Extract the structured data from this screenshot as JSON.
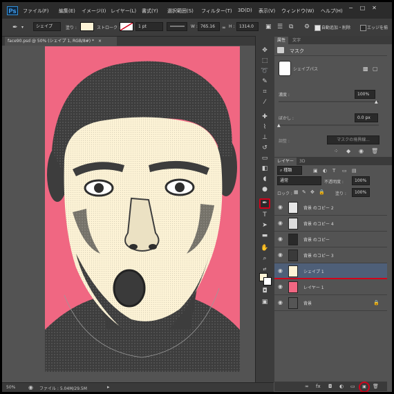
{
  "app": {
    "logo": "Ps"
  },
  "menu": [
    "ファイル(F)",
    "編集(E)",
    "イメージ(I)",
    "レイヤー(L)",
    "書式(Y)",
    "選択範囲(S)",
    "フィルター(T)",
    "3D(D)",
    "表示(V)",
    "ウィンドウ(W)",
    "ヘルプ(H)"
  ],
  "window_controls": [
    "−",
    "□",
    "✕"
  ],
  "options": {
    "tool_mode": "シェイプ",
    "fill_label": "塗り :",
    "fill_color": "#fdf3d6",
    "stroke_label": "ストローク :",
    "stroke_width": "1 pt",
    "w_label": "W :",
    "w_value": "765.16",
    "h_label": "H :",
    "h_value": "1314.0",
    "auto_add_delete": "自動追加・削除",
    "align_edges": "エッジを揃"
  },
  "document_tab": {
    "title": "face90.psd @ 50% (シェイプ 1, RGB/8#) *",
    "close": "×"
  },
  "status": {
    "zoom": "50%",
    "file_info": "ファイル : 5.04M/29.5M"
  },
  "properties": {
    "tabs": [
      "属性",
      "文字"
    ],
    "mask_title": "マスク",
    "shape_path": "シェイプパス",
    "density_label": "濃度 :",
    "density_value": "100%",
    "feather_label": "ぼかし :",
    "feather_value": "0.0 px",
    "refine_label": "調整 :",
    "mask_edge_button": "マスクの境界線..."
  },
  "layers_panel": {
    "tabs": [
      "レイヤー",
      "3D"
    ],
    "filter_kind": "種類",
    "blend_mode": "通常",
    "opacity_label": "不透明度 :",
    "opacity_value": "100%",
    "lock_label": "ロック :",
    "fill_label": "塗り :",
    "fill_value": "100%",
    "layers": [
      {
        "name": "背景 のコピー 2",
        "thumb_color": "#e8e8e8",
        "selected": false
      },
      {
        "name": "背景 のコピー 4",
        "thumb_color": "#dcdcdc",
        "selected": false
      },
      {
        "name": "背景 のコピー",
        "thumb_color": "#2a2a2a",
        "selected": false
      },
      {
        "name": "背景 のコピー 3",
        "thumb_color": "#3a3a3a",
        "selected": false
      },
      {
        "name": "シェイプ 1",
        "thumb_color": "#fdf3d6",
        "selected": true
      },
      {
        "name": "レイヤー 1",
        "thumb_color": "#f06782",
        "selected": false
      },
      {
        "name": "背景",
        "thumb_color": "#555555",
        "selected": false,
        "locked": true
      }
    ]
  },
  "colors": {
    "canvas_pink": "#f06782",
    "skin": "#fdf3d6",
    "dark_halftone": "#3d3d3d",
    "selection_blue": "#4e5f78",
    "highlight_red": "#d0021b"
  }
}
